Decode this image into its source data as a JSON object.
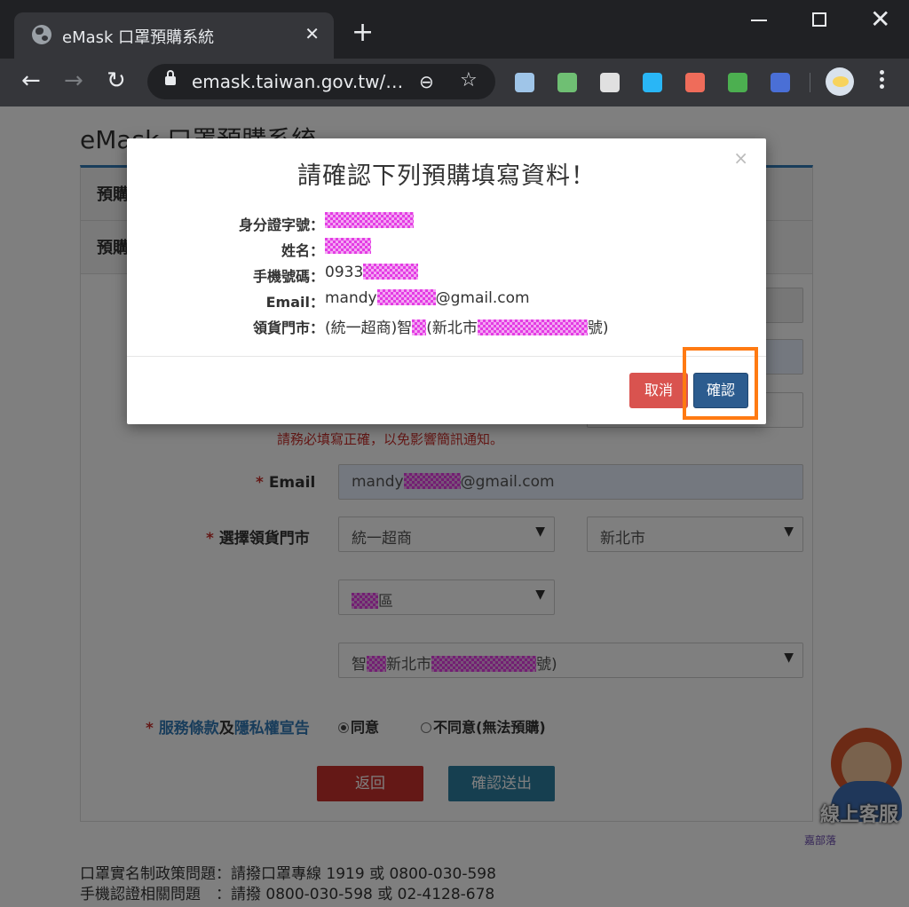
{
  "browser": {
    "tab_title": "eMask 口罩預購系統",
    "tab_close": "✕",
    "new_tab": "+",
    "url": "emask.taiwan.gov.tw/…",
    "back": "←",
    "forward": "→",
    "reload": "↻",
    "zoom_icon": "⊖",
    "star_icon": "☆",
    "window_close": "✕",
    "extension_colors": [
      "#9fc5e8",
      "#6fbf73",
      "#e0e0e0",
      "#29b6f6",
      "#ef6c5a",
      "#4caf50",
      "#4a6fd6"
    ]
  },
  "page": {
    "title": "eMask 口罩預購系統",
    "panel_row_1": "預購",
    "panel_row_2": "預購",
    "warn_text": "請務必填寫正確，以免影響簡訊通知。",
    "email_label": "Email",
    "email_value_prefix": "mandy",
    "email_value_suffix": "@gmail.com",
    "store_label": "選擇領貨門市",
    "store_chain": "統一超商",
    "store_city": "新北市",
    "store_district_suffix": "區",
    "store_name_prefix": "智",
    "store_name_mid": "新北市",
    "store_name_suffix": "號)",
    "terms_link": "服務條款",
    "terms_and": "及",
    "privacy_link": "隱私權宣告",
    "agree": "同意",
    "disagree": "不同意(無法預購)",
    "back_button": "返回",
    "submit_button": "確認送出",
    "required_mark": "*",
    "footer_1": "口罩實名制政策問題：請撥口罩專線 1919 或 0800-030-598",
    "footer_2": "手機認證相關問題　：請撥 0800-030-598 或 02-4128-678",
    "cs_text": "線上客服",
    "cs_brand": "嘉部落"
  },
  "modal": {
    "close_icon": "×",
    "title": "請確認下列預購填寫資料！",
    "rows": [
      {
        "label": "身分證字號：",
        "value": ""
      },
      {
        "label": "姓名：",
        "value": ""
      },
      {
        "label": "手機號碼：",
        "value": "0933"
      },
      {
        "label": "Email：",
        "value_prefix": "mandy",
        "value_suffix": "@gmail.com"
      },
      {
        "label": "領貨門市：",
        "value_prefix": "(統一超商)智",
        "value_mid": "(新北市",
        "value_suffix": "號)"
      }
    ],
    "cancel": "取消",
    "confirm": "確認"
  },
  "colors": {
    "chrome_dark": "#202124",
    "chrome_tab": "#35363a",
    "panel_accent": "#337ab7",
    "cancel_red": "#d9534f",
    "confirm_blue": "#2c5c8f",
    "highlight_orange": "#ff7a12",
    "redaction_magenta": "#e43ce4"
  }
}
